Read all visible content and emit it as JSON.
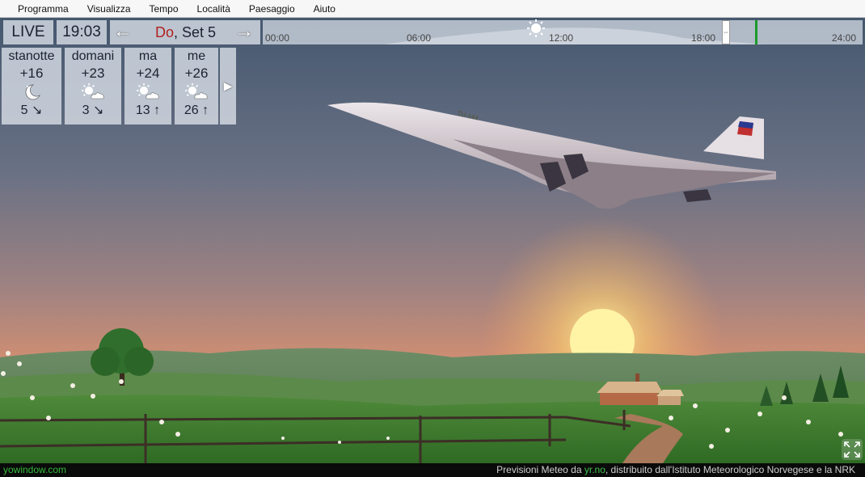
{
  "menu": [
    "Programma",
    "Visualizza",
    "Tempo",
    "Località",
    "Paesaggio",
    "Aiuto"
  ],
  "topbar": {
    "live_label": "LIVE",
    "time": "19:03",
    "date_day": "Do",
    "date_rest": ", Set 5",
    "arrow_left": "←",
    "arrow_right": "→"
  },
  "timeline": {
    "ticks": [
      "00:00",
      "06:00",
      "12:00",
      "18:00",
      "24:00"
    ]
  },
  "forecast": [
    {
      "name": "stanotte",
      "temp": "+16",
      "icon": "moon-icon",
      "wind": "5 ↘"
    },
    {
      "name": "domani",
      "temp": "+23",
      "icon": "sun-cloud-icon",
      "wind": "3 ↘"
    },
    {
      "name": "ma",
      "temp": "+24",
      "icon": "sun-cloud-icon",
      "wind": "13 ↑"
    },
    {
      "name": "me",
      "temp": "+26",
      "icon": "sun-cloud-icon",
      "wind": "26 ↑"
    }
  ],
  "forecast_more": "▶",
  "footer": {
    "brand": "yowindow.com",
    "credit_prefix": "Previsioni Meteo da ",
    "credit_link": "yr.no",
    "credit_suffix": ", distribuito dall'Istituto Meteorologico Norvegese e la NRK"
  },
  "airplane_livery": "TU-144",
  "colors": {
    "sky_top": "#4b6076",
    "sky_bottom": "#f19a64",
    "sun": "#fff6b0",
    "grass": "#3f7a2c",
    "now_marker": "#1a9a2a",
    "date_day": "#b32020"
  }
}
